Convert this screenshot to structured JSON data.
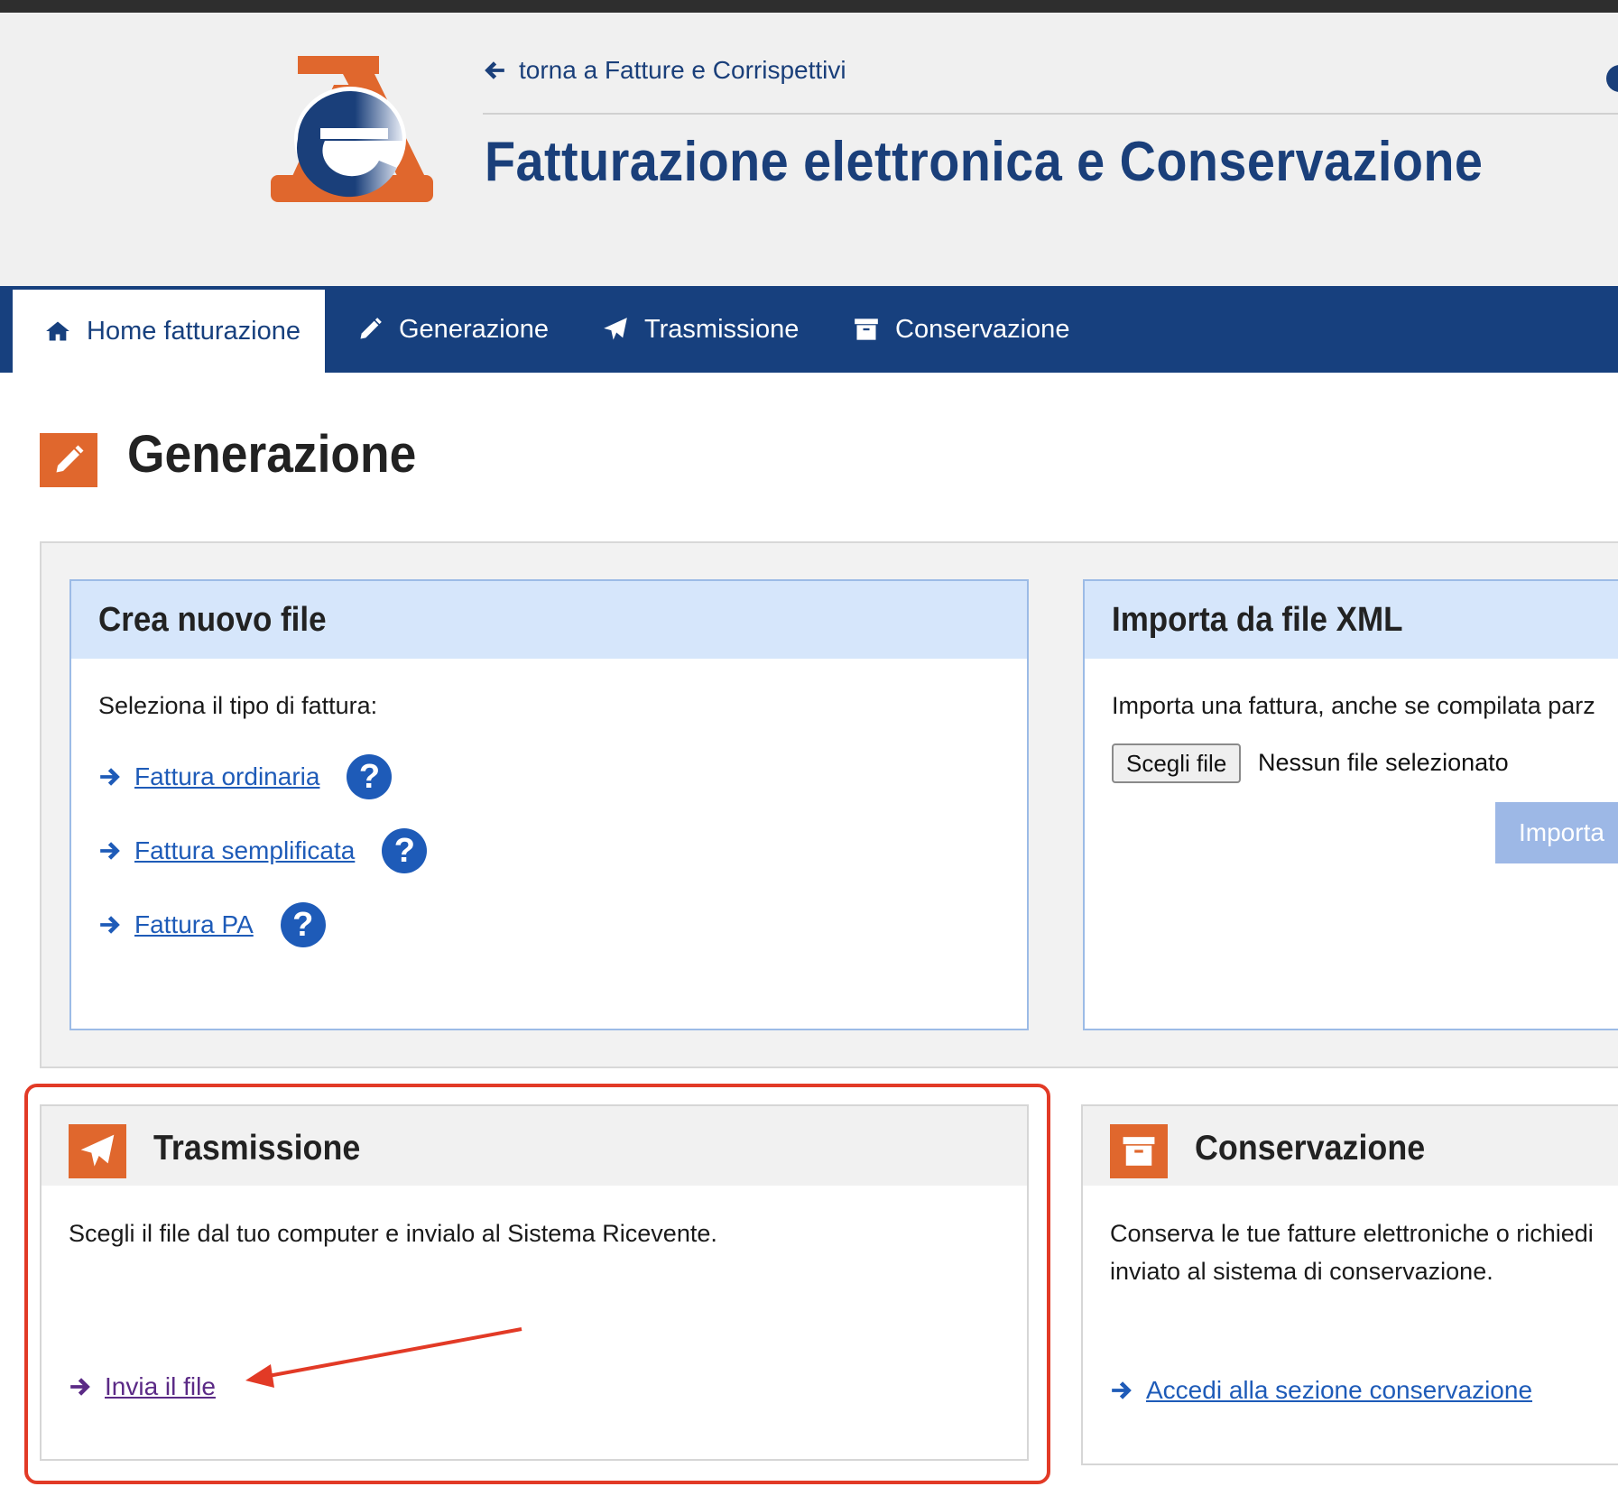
{
  "header": {
    "back_link": "torna a Fatture e Corrispettivi",
    "title": "Fatturazione elettronica e Conservazione"
  },
  "nav": {
    "items": [
      {
        "label": "Home fatturazione",
        "icon": "home-icon",
        "active": true
      },
      {
        "label": "Generazione",
        "icon": "pencil-icon",
        "active": false
      },
      {
        "label": "Trasmissione",
        "icon": "paper-plane-icon",
        "active": false
      },
      {
        "label": "Conservazione",
        "icon": "archive-icon",
        "active": false
      }
    ]
  },
  "page": {
    "title": "Generazione"
  },
  "crea": {
    "title": "Crea nuovo file",
    "prompt": "Seleziona il tipo di fattura:",
    "links": [
      {
        "label": "Fattura ordinaria",
        "help": "?"
      },
      {
        "label": "Fattura semplificata",
        "help": "?"
      },
      {
        "label": "Fattura PA",
        "help": "?"
      }
    ]
  },
  "importa": {
    "title": "Importa da file XML",
    "text": "Importa una fattura, anche se compilata parz",
    "file_button": "Scegli file",
    "file_status": "Nessun file selezionato",
    "import_button": "Importa"
  },
  "trasmissione": {
    "title": "Trasmissione",
    "text": "Scegli il file dal tuo computer e invialo al Sistema Ricevente.",
    "link": "Invia il file"
  },
  "conservazione": {
    "title": "Conservazione",
    "text_line1": "Conserva le tue fatture elettroniche o richiedi",
    "text_line2": "inviato al sistema di conservazione.",
    "link": "Accedi alla sezione conservazione"
  },
  "colors": {
    "brand_blue": "#17407e",
    "accent_orange": "#e0672d",
    "link_blue": "#1e5bb8",
    "visited_purple": "#5b2a86",
    "annotation_red": "#e23a26"
  }
}
